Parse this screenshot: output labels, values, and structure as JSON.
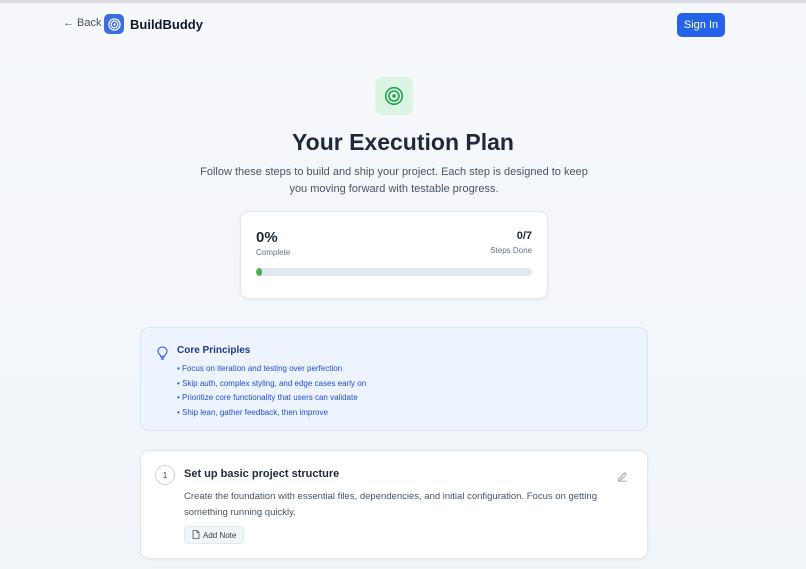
{
  "header": {
    "back_label": "Back",
    "back_icon": "arrow-left-icon",
    "brand_name": "BuildBuddy",
    "brand_icon": "target-icon",
    "signin_label": "Sign In",
    "accent_color": "#2563eb"
  },
  "hero": {
    "icon": "target-icon",
    "title": "Your Execution Plan",
    "subtitle": "Follow these steps to build and ship your project. Each step is designed to keep you moving forward with testable progress."
  },
  "progress": {
    "percent_text": "0%",
    "percent_label": "Complete",
    "steps_text": "0/7",
    "steps_label": "Steps Done",
    "fraction": 0.02
  },
  "principles": {
    "icon": "lightbulb-icon",
    "title": "Core Principles",
    "items": [
      "Focus on iteration and testing over perfection",
      "Skip auth, complex styling, and edge cases early on",
      "Prioritize core functionality that users can validate",
      "Ship lean, gather feedback, then improve"
    ]
  },
  "steps": [
    {
      "number": "1",
      "title": "Set up basic project structure",
      "description": "Create the foundation with essential files, dependencies, and initial configuration. Focus on getting something running quickly.",
      "add_note_label": "Add Note",
      "edit_icon": "pencil-icon",
      "note_icon": "document-icon"
    }
  ]
}
